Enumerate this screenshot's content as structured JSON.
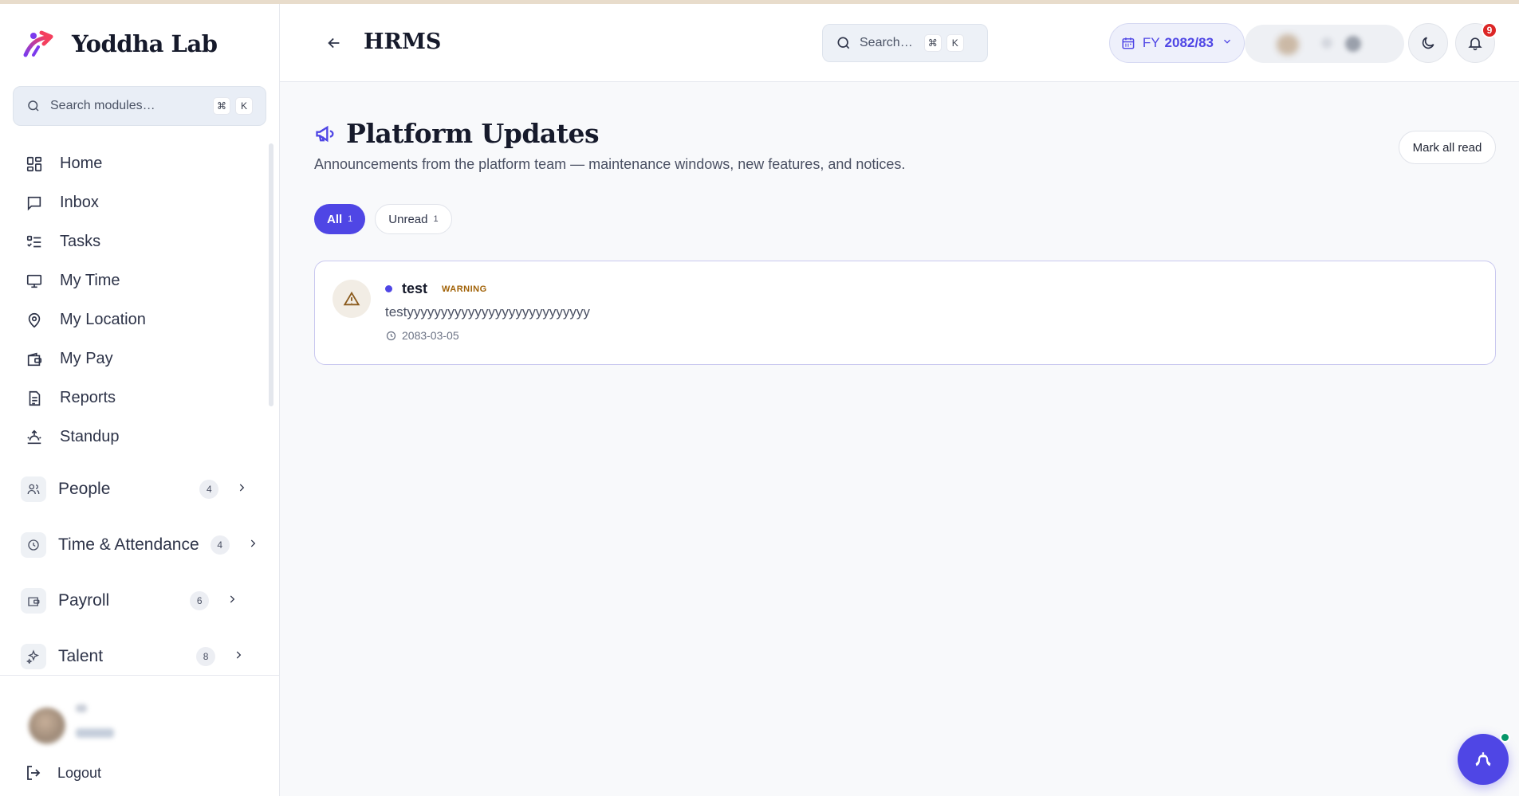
{
  "brand": {
    "name": "Yoddha Lab"
  },
  "sidebar": {
    "search_placeholder": "Search modules…",
    "kbd_cmd": "⌘",
    "kbd_k": "K",
    "items": [
      {
        "label": "Home",
        "icon": "grid-icon"
      },
      {
        "label": "Inbox",
        "icon": "message-icon"
      },
      {
        "label": "Tasks",
        "icon": "tasks-icon"
      },
      {
        "label": "My Time",
        "icon": "monitor-icon"
      },
      {
        "label": "My Location",
        "icon": "map-pin-icon"
      },
      {
        "label": "My Pay",
        "icon": "wallet-icon"
      },
      {
        "label": "Reports",
        "icon": "document-icon"
      },
      {
        "label": "Standup",
        "icon": "sunrise-icon"
      }
    ],
    "groups": [
      {
        "label": "People",
        "count": "4"
      },
      {
        "label": "Time & Attendance",
        "count": "4"
      },
      {
        "label": "Payroll",
        "count": "6"
      },
      {
        "label": "Talent",
        "count": "8"
      }
    ],
    "logout_label": "Logout"
  },
  "header": {
    "title": "HRMS",
    "search_placeholder": "Search…",
    "kbd_cmd": "⌘",
    "kbd_k": "K",
    "fy_label": "FY",
    "fy_value": "2082/83",
    "notifications_count": "9"
  },
  "main": {
    "title": "Platform Updates",
    "subtitle": "Announcements from the platform team — maintenance windows, new features, and notices.",
    "mark_all_read": "Mark all read",
    "filters": [
      {
        "label": "All",
        "count": "1",
        "active": true
      },
      {
        "label": "Unread",
        "count": "1",
        "active": false
      }
    ],
    "announcements": [
      {
        "title": "test",
        "severity": "WARNING",
        "body": "testyyyyyyyyyyyyyyyyyyyyyyyyyyy",
        "date": "2083-03-05",
        "unread": true
      }
    ]
  },
  "colors": {
    "accent": "#4f46e5",
    "warning": "#a16207",
    "badge": "#dc2626",
    "online": "#059669"
  }
}
